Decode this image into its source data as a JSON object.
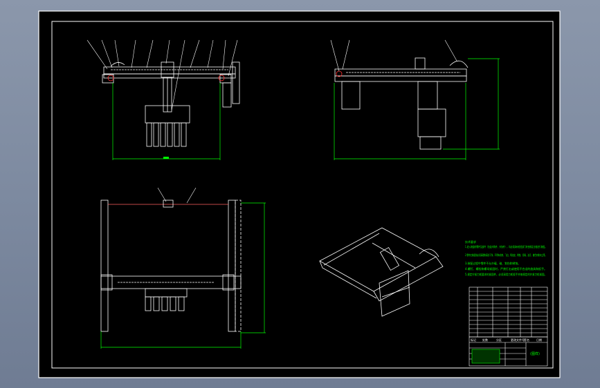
{
  "title_block": {
    "drawing_name": "(图样)",
    "header_cells": [
      "标记",
      "处数",
      "分区",
      "更改文件号",
      "签名",
      "日期"
    ]
  },
  "tech_notes": {
    "heading": "技术要求",
    "lines": [
      "1.进入装配的零件及部件（包括外购件、外协件），均必须具有检验部门的合格证方能进行装配。",
      "2.零件在装配前必须清理和清洗干净，不得有毛刺、飞边、氧化皮、锈蚀、切屑、油污、着色剂和灰尘等。",
      "3.装配过程中零件不允许磕、碰、划伤和锈蚀。",
      "4.螺钉、螺栓和螺母紧固时，严禁打击或使用不合适的旋具和扳手。",
      "5.规定拧紧力矩要求的紧固件，必须采用力矩扳手并按规定的拧紧力矩紧固。"
    ]
  },
  "colors": {
    "paper": "#000000",
    "outer_bg": "#7f8ba0",
    "geometry": "#ffffff",
    "dimension": "#00ff00",
    "leader": "#ffffff",
    "accent_red": "#ff3030",
    "accent_yellow": "#ffff00"
  },
  "views": [
    "front-view",
    "side-view",
    "top-view",
    "isometric-view"
  ]
}
